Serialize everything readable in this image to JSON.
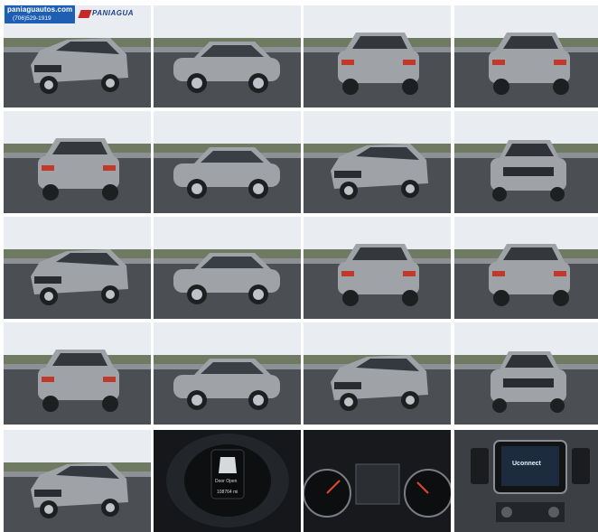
{
  "gallery": {
    "dealer": {
      "site": "paniaguautos.com",
      "phone": "(706)529-1919",
      "logo_text": "PANIAGUA"
    },
    "photos": [
      {
        "view": "front-left three-quarter"
      },
      {
        "view": "left side"
      },
      {
        "view": "rear-left three-quarter"
      },
      {
        "view": "rear"
      },
      {
        "view": "rear-left three-quarter"
      },
      {
        "view": "left side"
      },
      {
        "view": "front-left three-quarter"
      },
      {
        "view": "front"
      },
      {
        "view": "front-left three-quarter"
      },
      {
        "view": "left side"
      },
      {
        "view": "rear-left three-quarter"
      },
      {
        "view": "rear"
      },
      {
        "view": "rear-left three-quarter"
      },
      {
        "view": "left side"
      },
      {
        "view": "front-left three-quarter"
      },
      {
        "view": "front"
      },
      {
        "view": "front-left three-quarter"
      },
      {
        "view": "instrument cluster",
        "screen_text": "Door Open",
        "odometer": "108764 mi"
      },
      {
        "view": "gauges"
      },
      {
        "view": "infotainment",
        "screen_text": "Uconnect"
      }
    ],
    "colors": {
      "sky": "#e9edf2",
      "asphalt": "#4b4e52",
      "vehicle": "#9fa3a8",
      "dealer_blue": "#1f5fb3",
      "dealer_red": "#c62828"
    }
  }
}
